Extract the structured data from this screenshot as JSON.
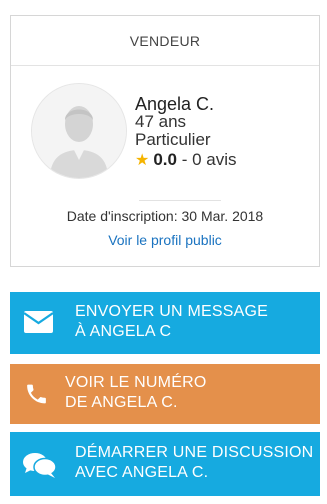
{
  "card": {
    "header": "VENDEUR",
    "name": "Angela C.",
    "age": "47 ans",
    "type": "Particulier",
    "rating_value": "0.0",
    "rating_suffix": " - 0 avis",
    "registration": "Date d'inscription: 30 Mar. 2018",
    "public_profile_link": "Voir le profil public"
  },
  "buttons": {
    "message": {
      "line1": "ENVOYER UN MESSAGE",
      "line2": "À ANGELA C",
      "icon": "envelope-icon"
    },
    "phone": {
      "line1": "VOIR LE NUMÉRO",
      "line2": "DE ANGELA C.",
      "icon": "phone-icon"
    },
    "chat": {
      "line1": "DÉMARRER UNE DISCUSSION",
      "line2": "AVEC ANGELA C.",
      "icon": "chat-bubbles-icon"
    }
  },
  "colors": {
    "accent_blue": "#16aae0",
    "accent_orange": "#e4904b",
    "link": "#1a73c0",
    "star": "#f5b400"
  }
}
